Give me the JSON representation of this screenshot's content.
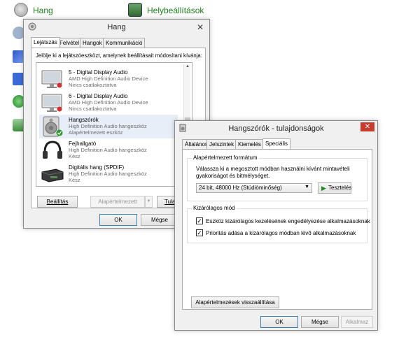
{
  "background": {
    "link_hang": "Hang",
    "link_region": "Helybeállítások"
  },
  "hang_dialog": {
    "title": "Hang",
    "tabs": [
      "Lejátszás",
      "Felvétel",
      "Hangok",
      "Kommunikáció"
    ],
    "instruction": "Jelölje ki a lejátszóeszközt, amelynek beállításait módosítani kívánja:",
    "devices": [
      {
        "name": "5 - Digital Display Audio",
        "line2": "AMD High Definition Audio Device",
        "line3": "Nincs csatlakoztatva",
        "icon": "monitor-icon"
      },
      {
        "name": "6 - Digital Display Audio",
        "line2": "AMD High Definition Audio Device",
        "line3": "Nincs csatlakoztatva",
        "icon": "monitor-icon"
      },
      {
        "name": "Hangszórók",
        "line2": "High Definition Audio hangeszköz",
        "line3": "Alapértelmezett eszköz",
        "icon": "speaker-icon"
      },
      {
        "name": "Fejhallgató",
        "line2": "High Definition Audio hangeszköz",
        "line3": "Kész",
        "icon": "headphones-icon"
      },
      {
        "name": "Digitális hang (SPDIF)",
        "line2": "High Definition Audio hangeszköz",
        "line3": "Kész",
        "icon": "spdif-icon"
      }
    ],
    "buttons": {
      "configure": "Beállítás",
      "set_default": "Alapértelmezett",
      "properties": "Tulajdo",
      "ok": "OK",
      "cancel": "Mégse"
    }
  },
  "props_dialog": {
    "title": "Hangszórók - tulajdonságok",
    "tabs": [
      "Általános",
      "Jelszintek",
      "Kiemelés",
      "Speciális"
    ],
    "default_format": {
      "legend": "Alapértelmezett formátum",
      "description": "Válassza ki a megosztott módban használni kívánt mintavételi gyakoriságot és bitmélységet.",
      "selected": "24 bit, 48000 Hz (Stúdióminőség)",
      "test_button": "Tesztelés"
    },
    "exclusive_mode": {
      "legend": "Kizárólagos mód",
      "option1": "Eszköz kizárólagos kezelésének engedélyezése alkalmazásoknak",
      "option2": "Prioritás adása a kizárólagos módban lévő alkalmazásoknak",
      "option1_checked": true,
      "option2_checked": true
    },
    "restore_button": "Alapértelmezések visszaállítása",
    "buttons": {
      "ok": "OK",
      "cancel": "Mégse",
      "apply": "Alkalmaz"
    }
  }
}
